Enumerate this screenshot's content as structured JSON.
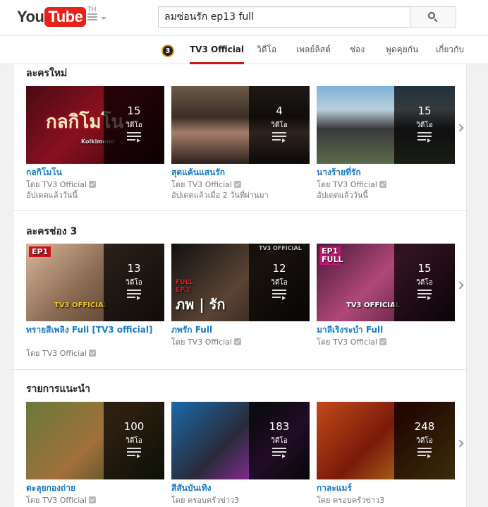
{
  "masthead": {
    "logo_you": "You",
    "logo_tube": "Tube",
    "logo_country": "TH",
    "search_value": "ลมซ่อนรัก ep13 full"
  },
  "channel": {
    "logo_text": "3",
    "tabs": [
      {
        "label": "TV3 Official",
        "active": true
      },
      {
        "label": "วิดีโอ"
      },
      {
        "label": "เพลย์ลิสต์"
      },
      {
        "label": "ช่อง"
      },
      {
        "label": "พูดคุยกัน"
      },
      {
        "label": "เกี่ยวกับ"
      }
    ]
  },
  "shelves": [
    {
      "title": "ละครใหม่",
      "items": [
        {
          "title": "กลกิโมโน",
          "count": "15",
          "unit": "วิดีโอ",
          "by": "โดย TV3 Official",
          "updated": "อัปเดตแล้ววันนี้",
          "thumb_text": "กลกิโมโน",
          "thumb_sub": "Kolkimono"
        },
        {
          "title": "สุดแค้นแสนรัก",
          "count": "4",
          "unit": "วิดีโอ",
          "by": "โดย TV3 Official",
          "updated": "อัปเดตแล้วเมื่อ 2 วันที่ผ่านมา"
        },
        {
          "title": "นางร้ายที่รัก",
          "count": "15",
          "unit": "วิดีโอ",
          "by": "โดย TV3 Official",
          "updated": "อัปเดตแล้ววันนี้"
        }
      ]
    },
    {
      "title": "ละครช่อง 3",
      "items": [
        {
          "title": "ทรายสีเพลิง Full [TV3 official]",
          "count": "13",
          "unit": "วิดีโอ",
          "by": "โดย TV3 Official",
          "thumb_badge": "EP1",
          "thumb_text": "TV3 OFFICIAL"
        },
        {
          "title": "ภพรัก Full",
          "count": "12",
          "unit": "วิดีโอ",
          "by": "โดย TV3 Official",
          "thumb_badge": "FULL EP.1",
          "thumb_text": "ภพ | รัก",
          "thumb_corner": "TV3 OFFICIAL"
        },
        {
          "title": "มาลีเริงระบำ Full",
          "count": "15",
          "unit": "วิดีโอ",
          "by": "โดย TV3 Official",
          "thumb_badge": "EP1 FULL",
          "thumb_text": "TV3 OFFICIAL"
        }
      ]
    },
    {
      "title": "รายการแนะนำ",
      "items": [
        {
          "title": "ตะลุยกองถ่าย",
          "count": "100",
          "unit": "วิดีโอ",
          "by": "โดย TV3 Official"
        },
        {
          "title": "สีสันบันเทิง",
          "count": "183",
          "unit": "วิดีโอ",
          "by": "โดย ครอบครัวข่าว3"
        },
        {
          "title": "กาละแมร์",
          "count": "248",
          "unit": "วิดีโอ",
          "by": "โดย ครอบครัวข่าว3"
        }
      ]
    }
  ],
  "colors": {
    "brand_red": "#e62117",
    "link_blue": "#167ac6",
    "active_tab_underline": "#cc181e"
  }
}
